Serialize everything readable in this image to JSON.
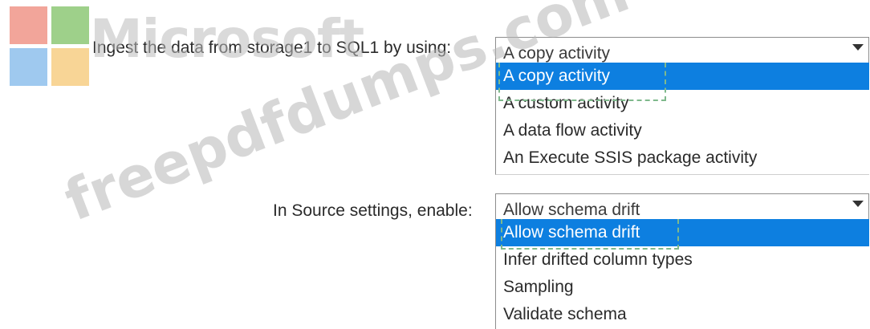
{
  "watermark": {
    "logo_word": "Microsoft",
    "url": "freepdfdumps.com"
  },
  "question1": {
    "label": "Ingest the data from storage1 to SQL1 by using:",
    "selected_value": "A copy activity",
    "options": [
      "A copy activity",
      "A custom activity",
      "A data flow activity",
      "An Execute SSIS package activity"
    ],
    "highlighted_option": "A copy activity"
  },
  "question2": {
    "label": "In Source settings, enable:",
    "selected_value": "Allow schema drift",
    "options": [
      "Allow schema drift",
      "Infer drifted column types",
      "Sampling",
      "Validate schema"
    ],
    "highlighted_option": "Allow schema drift"
  },
  "colors": {
    "highlight": "#0d7fe0",
    "dashed_marker": "#7fb98c"
  },
  "icons": {
    "dropdown": "chevron-down-icon"
  }
}
